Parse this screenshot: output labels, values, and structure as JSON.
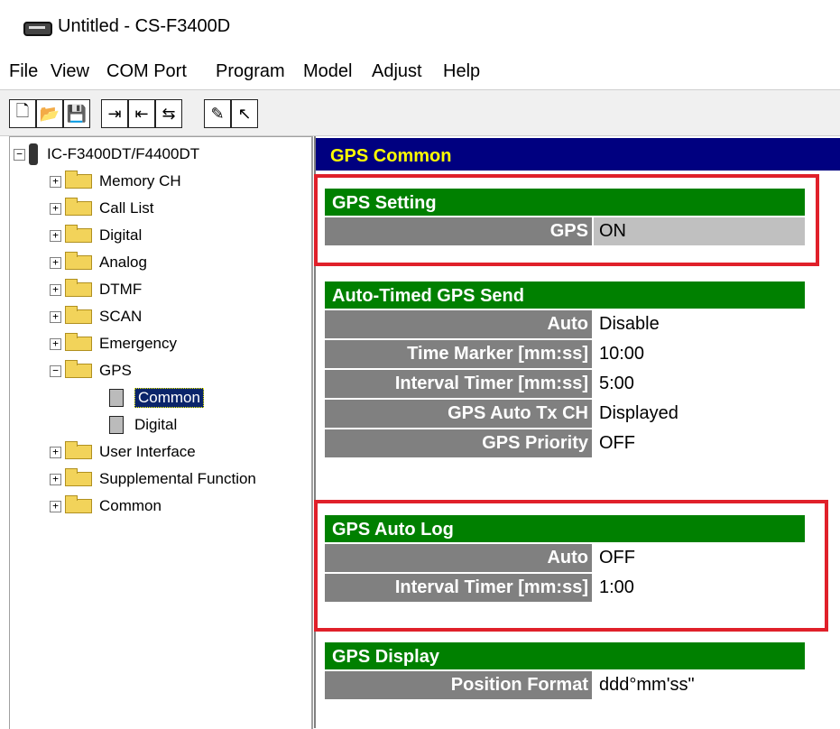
{
  "window": {
    "title": "Untitled - CS-F3400D"
  },
  "menu": [
    "File",
    "View",
    "COM Port",
    "Program",
    "Model",
    "Adjust",
    "Help"
  ],
  "tree": {
    "root": "IC-F3400DT/F4400DT",
    "items": [
      {
        "label": "Memory CH",
        "expander": "+"
      },
      {
        "label": "Call List",
        "expander": "+"
      },
      {
        "label": "Digital",
        "expander": "+"
      },
      {
        "label": "Analog",
        "expander": "+"
      },
      {
        "label": "DTMF",
        "expander": "+"
      },
      {
        "label": "SCAN",
        "expander": "+"
      },
      {
        "label": "Emergency",
        "expander": "+"
      },
      {
        "label": "GPS",
        "expander": "−"
      },
      {
        "label": "Common",
        "child": true,
        "selected": true
      },
      {
        "label": "Digital",
        "child": true
      },
      {
        "label": "User Interface",
        "expander": "+"
      },
      {
        "label": "Supplemental Function",
        "expander": "+"
      },
      {
        "label": "Common",
        "expander": "+"
      }
    ]
  },
  "panel": {
    "header": "GPS Common",
    "gps_setting": {
      "title": "GPS Setting",
      "rows": [
        {
          "label": "GPS",
          "value": "ON"
        }
      ]
    },
    "auto_timed": {
      "title": "Auto-Timed GPS Send",
      "rows": [
        {
          "label": "Auto",
          "value": "Disable"
        },
        {
          "label": "Time Marker [mm:ss]",
          "value": "10:00"
        },
        {
          "label": "Interval Timer [mm:ss]",
          "value": " 5:00"
        },
        {
          "label": "GPS Auto Tx CH",
          "value": "Displayed"
        },
        {
          "label": "GPS Priority",
          "value": "OFF"
        }
      ]
    },
    "auto_log": {
      "title": "GPS Auto Log",
      "rows": [
        {
          "label": "Auto",
          "value": "OFF"
        },
        {
          "label": "Interval Timer [mm:ss]",
          "value": "1:00"
        }
      ]
    },
    "display": {
      "title": "GPS Display",
      "rows": [
        {
          "label": "Position Format",
          "value": "ddd°mm'ss\""
        }
      ]
    }
  },
  "colors": {
    "header_bg": "#000080",
    "header_fg": "#ffff00",
    "section_bg": "#008000",
    "label_bg": "#808080",
    "highlight": "#e0202a"
  }
}
